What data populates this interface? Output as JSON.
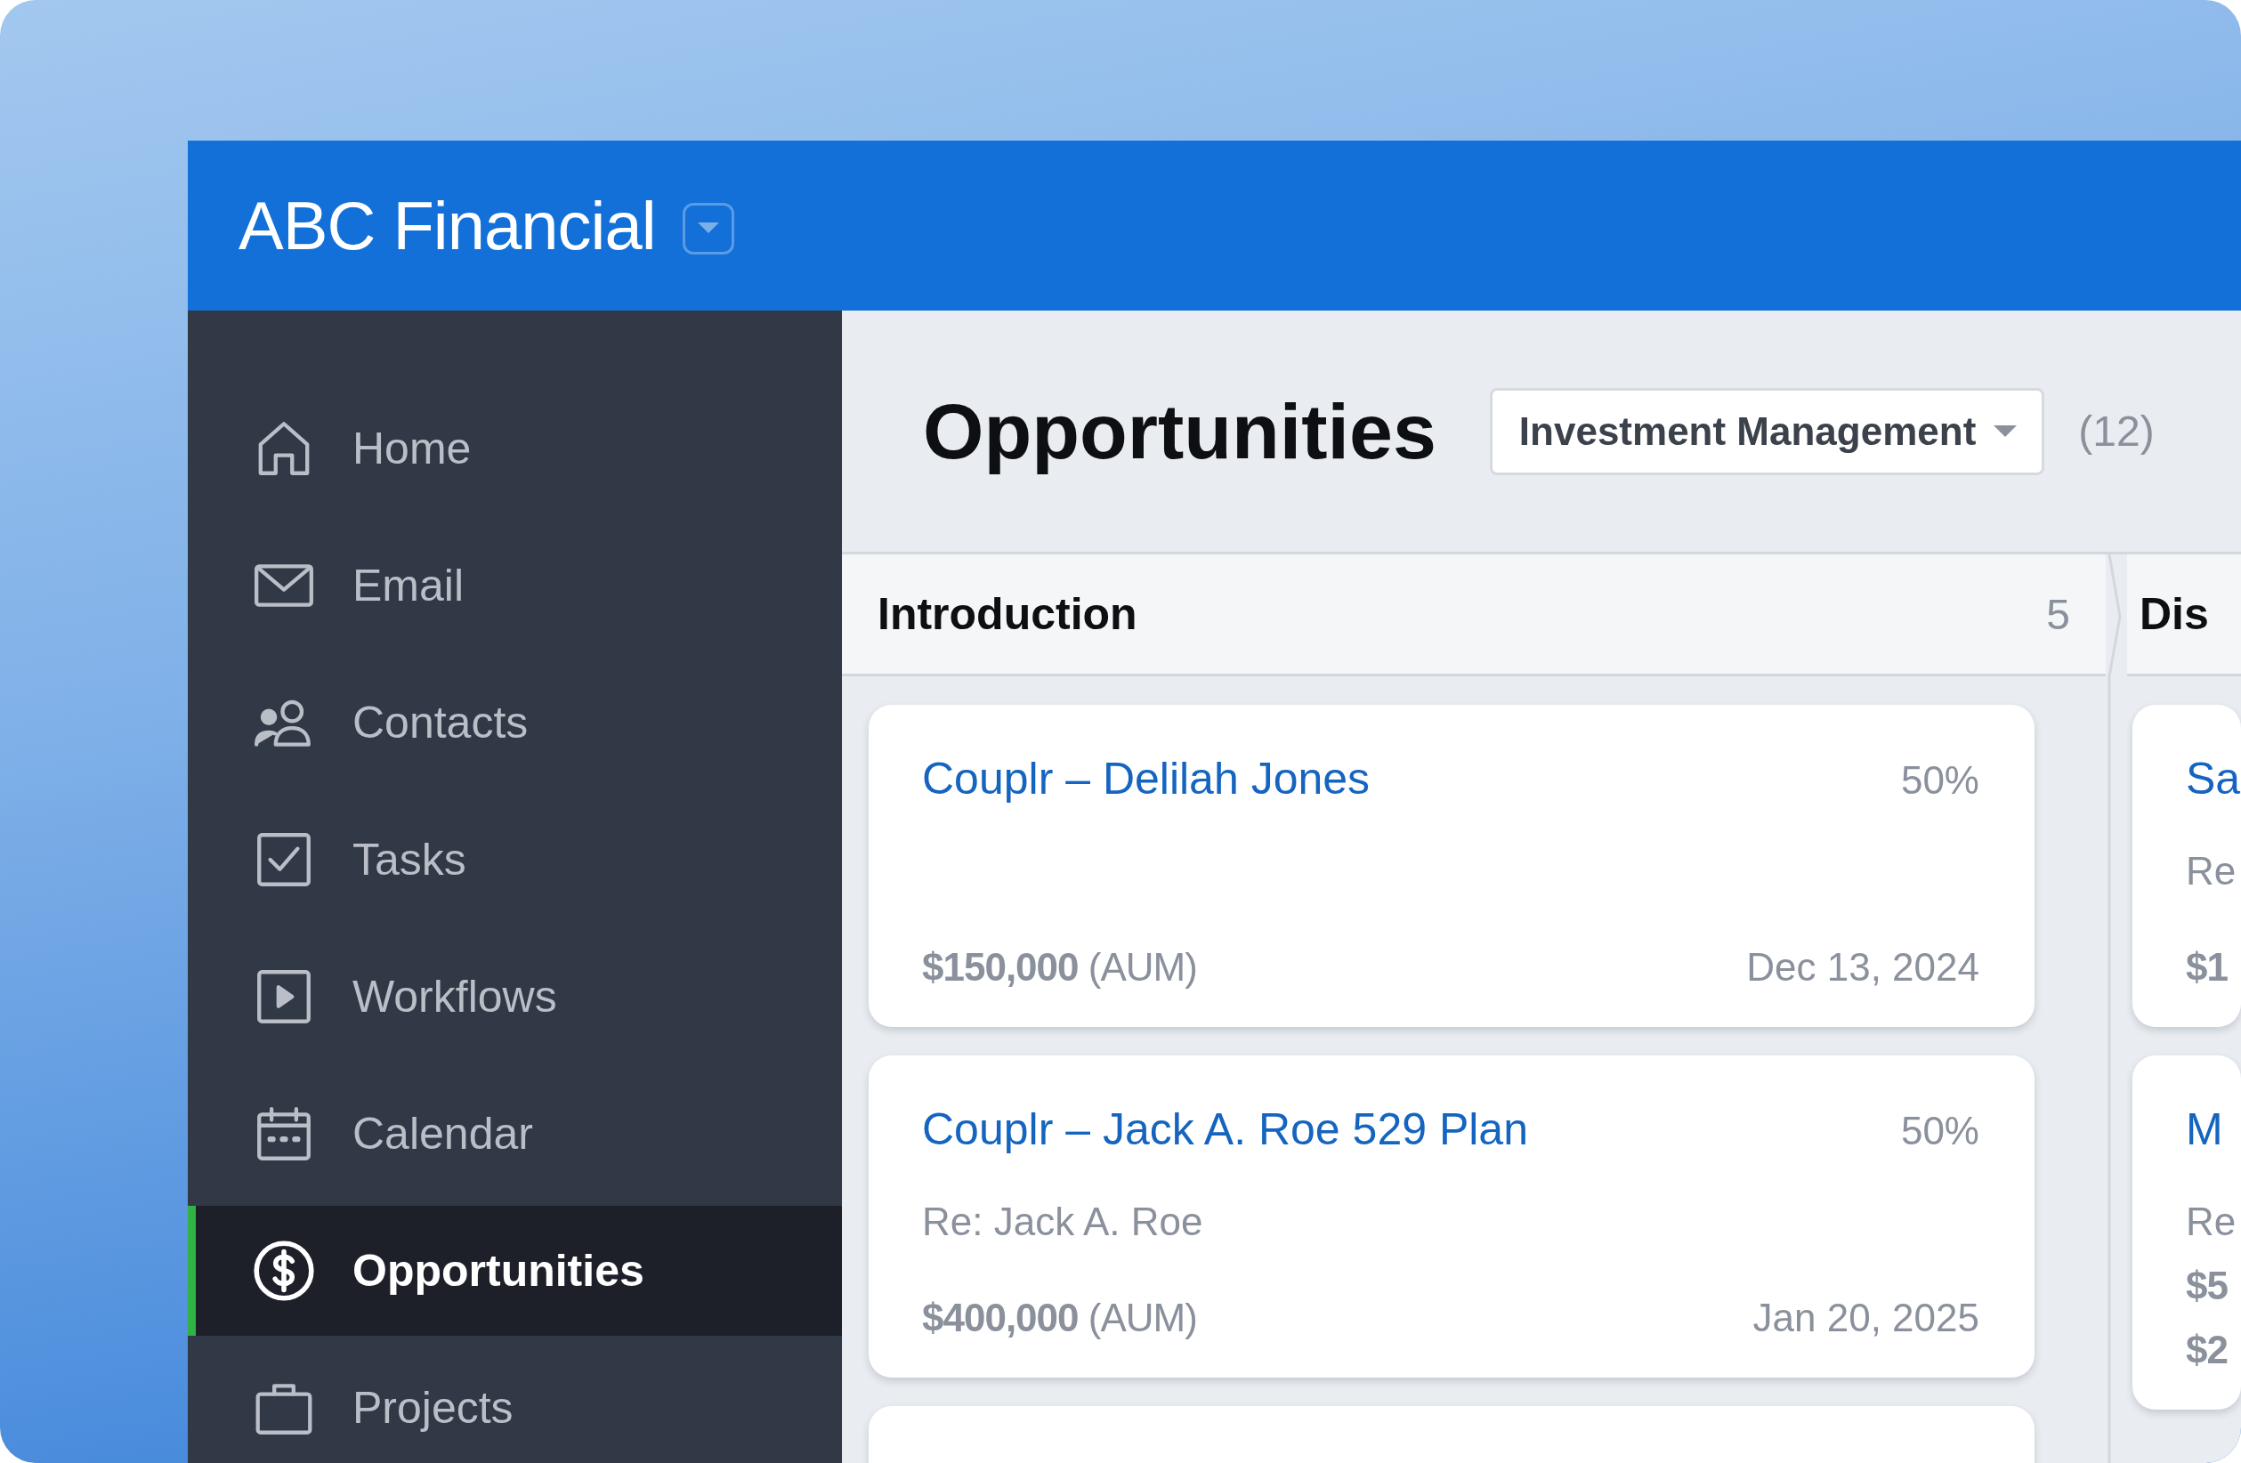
{
  "header": {
    "title": "ABC Financial"
  },
  "sidebar": {
    "items": [
      {
        "label": "Home",
        "selected": false
      },
      {
        "label": "Email",
        "selected": false
      },
      {
        "label": "Contacts",
        "selected": false
      },
      {
        "label": "Tasks",
        "selected": false
      },
      {
        "label": "Workflows",
        "selected": false
      },
      {
        "label": "Calendar",
        "selected": false
      },
      {
        "label": "Opportunities",
        "selected": true
      },
      {
        "label": "Projects",
        "selected": false
      }
    ]
  },
  "page": {
    "title": "Opportunities",
    "filter": "Investment Management",
    "count": "(12)"
  },
  "columns": [
    {
      "title": "Introduction",
      "count": "5",
      "more_below": true,
      "cards": [
        {
          "title": "Couplr – Delilah Jones",
          "percent": "50%",
          "amounts": [
            "**$150,000** (AUM)"
          ],
          "date": "Dec 13, 2024"
        },
        {
          "title": "Couplr – Jack A. Roe 529 Plan",
          "percent": "50%",
          "re": "Re: Jack A. Roe",
          "amounts": [
            "**$400,000** (AUM)"
          ],
          "date": "Jan 20, 2025"
        }
      ]
    },
    {
      "title": "Dis",
      "cards": [
        {
          "title": "Sa",
          "re": "Re",
          "amounts": [
            "**$1**"
          ]
        },
        {
          "title": "M",
          "re": "Re",
          "amounts": [
            "**$5**",
            "**$2**"
          ]
        }
      ]
    }
  ]
}
